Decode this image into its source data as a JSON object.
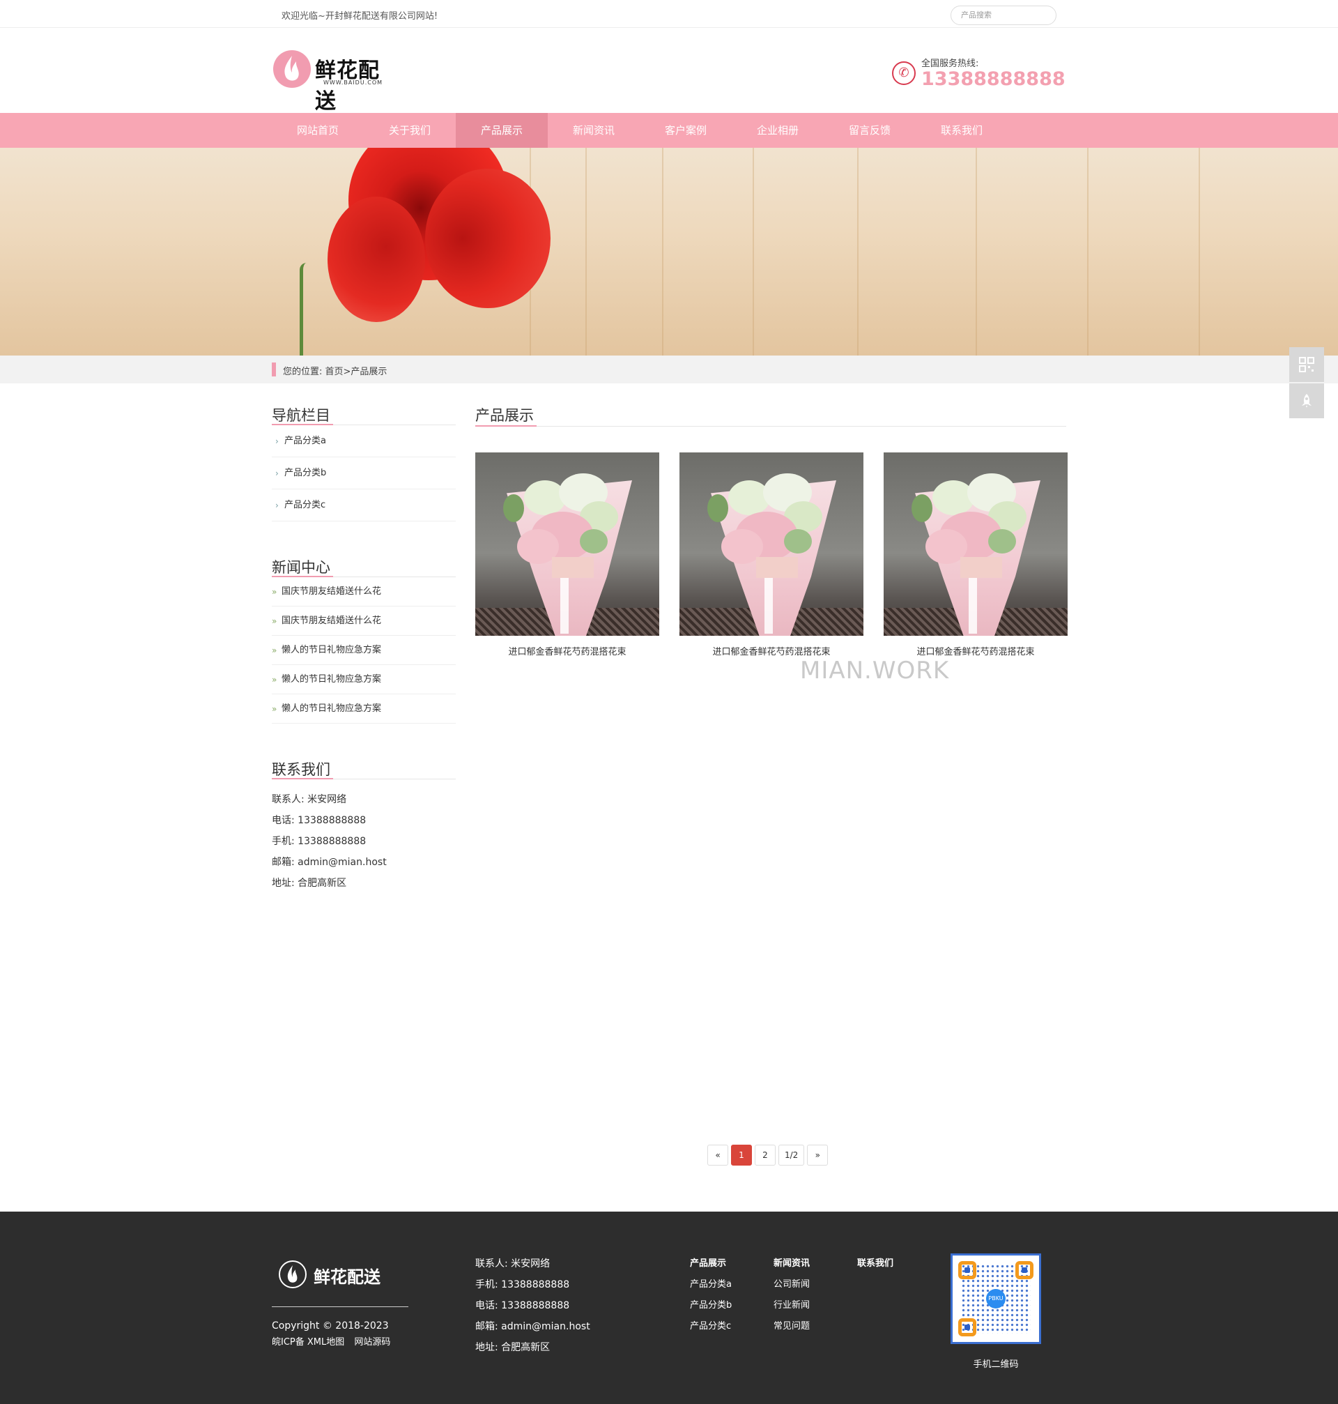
{
  "topbar": {
    "welcome": "欢迎光临~开封鲜花配送有限公司网站!",
    "search_placeholder": "产品搜索"
  },
  "header": {
    "logo_text": "鲜花配送",
    "logo_sub": "WWW.BAIDU.COM",
    "hotline_label": "全国服务热线:",
    "hotline_number": "13388888888"
  },
  "nav": {
    "items": [
      {
        "label": "网站首页"
      },
      {
        "label": "关于我们"
      },
      {
        "label": "产品展示"
      },
      {
        "label": "新闻资讯"
      },
      {
        "label": "客户案例"
      },
      {
        "label": "企业相册"
      },
      {
        "label": "留言反馈"
      },
      {
        "label": "联系我们"
      }
    ],
    "active_index": 2
  },
  "breadcrumb": {
    "text": "您的位置: 首页>产品展示"
  },
  "sidebar": {
    "nav_title": "导航栏目",
    "categories": [
      "产品分类a",
      "产品分类b",
      "产品分类c"
    ],
    "news_title": "新闻中心",
    "news": [
      "国庆节朋友结婚送什么花",
      "国庆节朋友结婚送什么花",
      "懒人的节日礼物应急方案",
      "懒人的节日礼物应急方案",
      "懒人的节日礼物应急方案"
    ],
    "contact_title": "联系我们",
    "contact": [
      "联系人: 米安网络",
      "电话: 13388888888",
      "手机: 13388888888",
      "邮箱: admin@mian.host",
      "地址: 合肥高新区"
    ]
  },
  "main": {
    "title": "产品展示",
    "products": [
      {
        "name": "进口郁金香鲜花芍药混搭花束"
      },
      {
        "name": "进口郁金香鲜花芍药混搭花束"
      },
      {
        "name": "进口郁金香鲜花芍药混搭花束"
      }
    ],
    "watermark": "MIAN.WORK"
  },
  "pager": {
    "prev": "«",
    "pages": [
      "1",
      "2"
    ],
    "active": "1",
    "info": "1/2",
    "next": "»"
  },
  "footer": {
    "logo_text": "鲜花配送",
    "copyright": "Copyright © 2018-2023",
    "icp": "皖ICP备",
    "xml_map": "XML地图",
    "source": "网站源码",
    "contact": [
      "联系人: 米安网络",
      "手机: 13388888888",
      "电话: 13388888888",
      "邮箱: admin@mian.host",
      "地址: 合肥高新区"
    ],
    "col1": [
      "产品展示",
      "产品分类a",
      "产品分类b",
      "产品分类c"
    ],
    "col2": [
      "新闻资讯",
      "公司新闻",
      "行业新闻",
      "常见问题"
    ],
    "col3": [
      "联系我们"
    ],
    "qr_label": "手机二维码",
    "qr_center": "PBKU"
  },
  "colors": {
    "brand_pink": "#f8a6b4",
    "nav_active": "#e88d9c",
    "pager_active": "#d9453a",
    "footer_bg": "#2d2d2d"
  },
  "icons": [
    "phone-icon",
    "logo-flame-icon",
    "qr-code-icon",
    "rocket-top-icon",
    "chevron-right-icon",
    "double-chevron-icon"
  ]
}
